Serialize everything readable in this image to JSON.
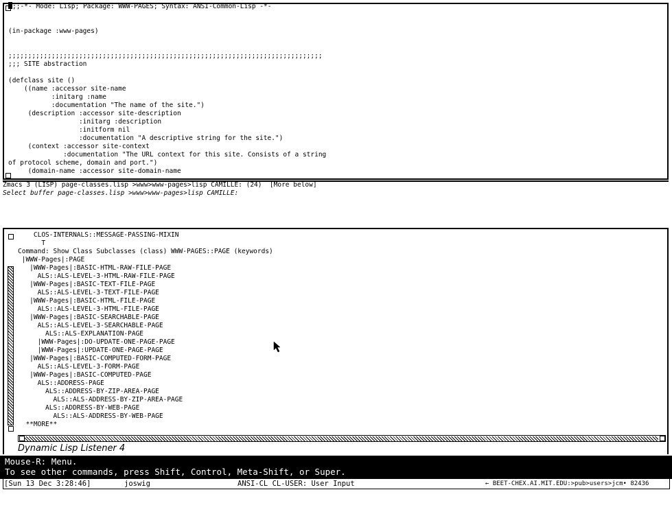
{
  "editor": {
    "lines": [
      ";;;-*- Mode: Lisp; Package: WWW-PAGES; Syntax: ANSI-Common-Lisp -*-",
      "",
      "",
      "(in-package :www-pages)",
      "",
      "",
      ";;;;;;;;;;;;;;;;;;;;;;;;;;;;;;;;;;;;;;;;;;;;;;;;;;;;;;;;;;;;;;;;;;;;;;;;;;;;;;;;",
      ";;; SITE abstraction",
      "",
      "(defclass site ()",
      "    ((name :accessor site-name",
      "           :initarg :name",
      "           :documentation \"The name of the site.\")",
      "     (description :accessor site-description",
      "                  :initarg :description",
      "                  :initform nil",
      "                  :documentation \"A descriptive string for the site.\")",
      "     (context :accessor site-context",
      "              :documentation \"The URL context for this site. Consists of a string",
      "of protocol scheme, domain and port.\")",
      "     (domain-name :accessor site-domain-name"
    ]
  },
  "modeline": "Zmacs 3 (LISP) page-classes.lisp >www>www-pages>lisp CAMILLE: (24)  [More below]",
  "minibuffer": "Select buffer page-classes.lisp >www>www-pages>lisp CAMILLE:",
  "listener": {
    "lines": [
      "    CLOS-INTERNALS::MESSAGE-PASSING-MIXIN",
      "      T",
      "Command: Show Class Subclasses (class) WWW-PAGES::PAGE (keywords)",
      " |WWW-Pages|:PAGE",
      "   |WWW-Pages|:BASIC-HTML-RAW-FILE-PAGE",
      "     ALS::ALS-LEVEL-3-HTML-RAW-FILE-PAGE",
      "   |WWW-Pages|:BASIC-TEXT-FILE-PAGE",
      "     ALS::ALS-LEVEL-3-TEXT-FILE-PAGE",
      "   |WWW-Pages|:BASIC-HTML-FILE-PAGE",
      "     ALS::ALS-LEVEL-3-HTML-FILE-PAGE",
      "   |WWW-Pages|:BASIC-SEARCHABLE-PAGE",
      "     ALS::ALS-LEVEL-3-SEARCHABLE-PAGE",
      "       ALS::ALS-EXPLANATION-PAGE",
      "     |WWW-Pages|:DO-UPDATE-ONE-PAGE-PAGE",
      "     |WWW-Pages|:UPDATE-ONE-PAGE-PAGE",
      "   |WWW-Pages|:BASIC-COMPUTED-FORM-PAGE",
      "     ALS::ALS-LEVEL-3-FORM-PAGE",
      "   |WWW-Pages|:BASIC-COMPUTED-PAGE",
      "     ALS::ADDRESS-PAGE",
      "       ALS::ADDRESS-BY-ZIP-AREA-PAGE",
      "         ALS::ALS-ADDRESS-BY-ZIP-AREA-PAGE",
      "       ALS::ADDRESS-BY-WEB-PAGE",
      "         ALS::ALS-ADDRESS-BY-WEB-PAGE",
      "  **MORE**"
    ]
  },
  "pane_label": "Dynamic Lisp Listener 4",
  "mouse_doc": {
    "line1": "Mouse-R: Menu.",
    "line2": "To see other commands, press Shift, Control, Meta-Shift, or Super."
  },
  "status": {
    "datetime": "[Sun 13 Dec 3:28:46]",
    "user": "joswig",
    "package": "ANSI-CL CL-USER: User Input",
    "path": "← BEET-CHEX.AI.MIT.EDU:>pub>users>jcm• 82436"
  },
  "icons": [
    "mouse-pointer-icon"
  ]
}
